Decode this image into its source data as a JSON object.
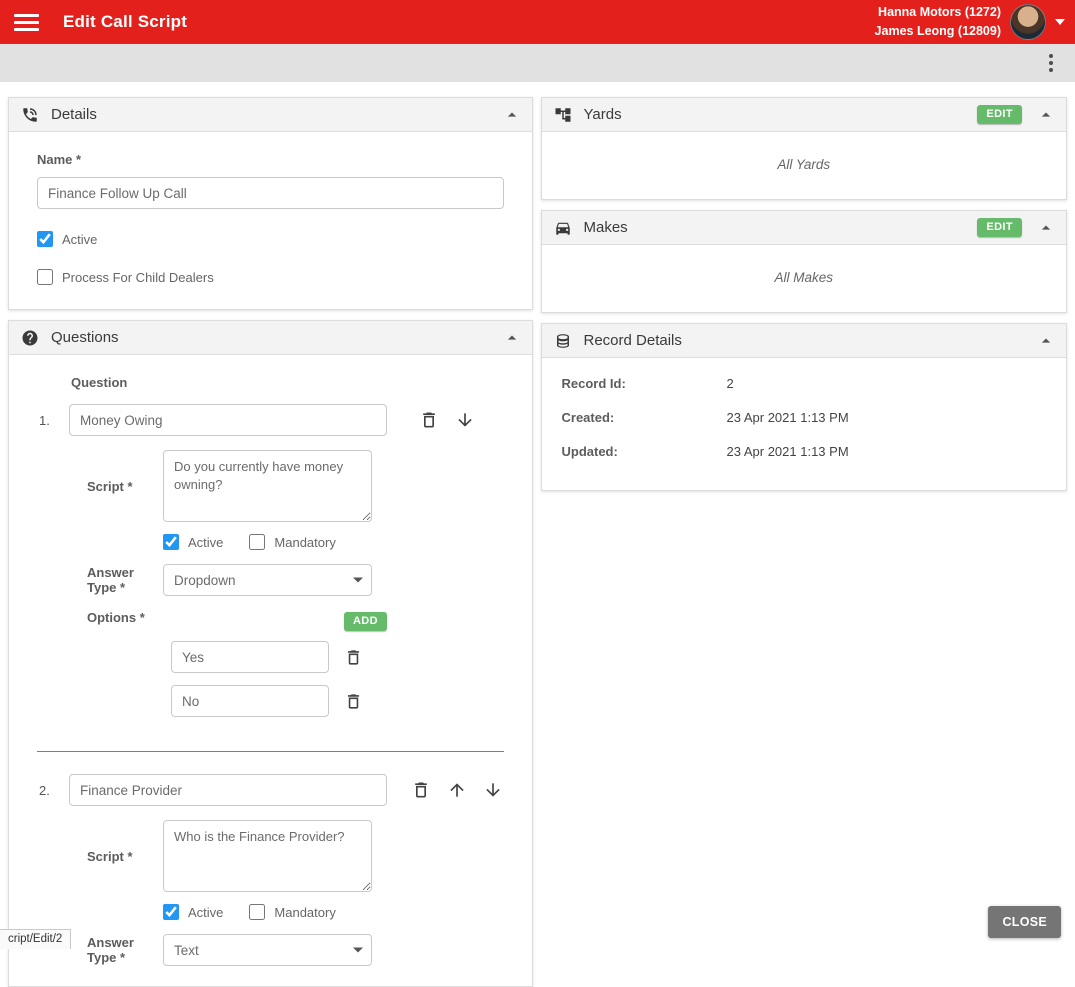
{
  "colors": {
    "header_red": "#e4201c",
    "accent_green": "#66bb6a",
    "checkbox_blue": "#2196f3",
    "divider_blue": "#2196f3",
    "close_gray": "#757575"
  },
  "header": {
    "title": "Edit Call Script",
    "dealer": "Hanna Motors (1272)",
    "user": "James Leong (12809)"
  },
  "details": {
    "title": "Details",
    "name_label": "Name *",
    "name_value": "Finance Follow Up Call",
    "active_label": "Active",
    "active_checked": true,
    "child_dealers_label": "Process For Child Dealers",
    "child_dealers_checked": false
  },
  "questions": {
    "title": "Questions",
    "column_header": "Question",
    "items": [
      {
        "index": "1.",
        "name": "Money Owing",
        "script_label": "Script *",
        "script": "Do you currently have money owning?",
        "active_label": "Active",
        "active_checked": true,
        "mandatory_label": "Mandatory",
        "mandatory_checked": false,
        "answer_type_label": "Answer Type *",
        "answer_type": "Dropdown",
        "options_label": "Options *",
        "add_label": "ADD",
        "options": [
          "Yes",
          "No"
        ]
      },
      {
        "index": "2.",
        "name": "Finance Provider",
        "script_label": "Script *",
        "script": "Who is the Finance Provider?",
        "active_label": "Active",
        "active_checked": true,
        "mandatory_label": "Mandatory",
        "mandatory_checked": false,
        "answer_type_label": "Answer Type *",
        "answer_type": "Text"
      }
    ]
  },
  "yards": {
    "title": "Yards",
    "edit_label": "EDIT",
    "empty_text": "All Yards"
  },
  "makes": {
    "title": "Makes",
    "edit_label": "EDIT",
    "empty_text": "All Makes"
  },
  "record_details": {
    "title": "Record Details",
    "rows": [
      {
        "label": "Record Id:",
        "value": "2"
      },
      {
        "label": "Created:",
        "value": "23 Apr 2021 1:13 PM"
      },
      {
        "label": "Updated:",
        "value": "23 Apr 2021 1:13 PM"
      }
    ]
  },
  "footer": {
    "close_label": "CLOSE",
    "status_url": "cript/Edit/2"
  }
}
